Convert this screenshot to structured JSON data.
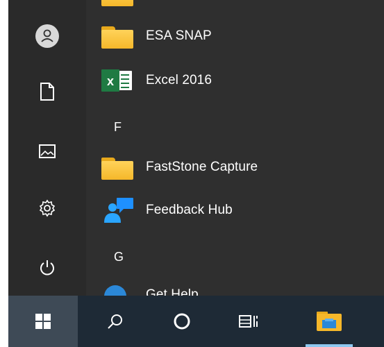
{
  "rail": {
    "items": [
      {
        "name": "user-account",
        "icon": "user-icon"
      },
      {
        "name": "documents",
        "icon": "document-icon"
      },
      {
        "name": "pictures",
        "icon": "pictures-icon"
      },
      {
        "name": "settings",
        "icon": "gear-icon"
      },
      {
        "name": "power",
        "icon": "power-icon"
      }
    ]
  },
  "app_list": {
    "apps": [
      {
        "label": "ESA SNAP",
        "icon": "folder-icon"
      },
      {
        "label": "Excel 2016",
        "icon": "excel-icon"
      },
      {
        "label": "FastStone Capture",
        "icon": "folder-icon"
      },
      {
        "label": "Feedback Hub",
        "icon": "feedback-hub-icon"
      },
      {
        "label": "Get Help",
        "icon": "get-help-icon"
      }
    ],
    "letters": [
      "F",
      "G"
    ]
  },
  "taskbar": {
    "items": [
      {
        "name": "start",
        "icon": "windows-icon"
      },
      {
        "name": "search",
        "icon": "search-icon"
      },
      {
        "name": "cortana",
        "icon": "cortana-icon"
      },
      {
        "name": "task-view",
        "icon": "task-view-icon"
      },
      {
        "name": "file-explorer",
        "icon": "file-explorer-icon"
      }
    ]
  },
  "colors": {
    "accent": "#8ec8f0",
    "folder": "#f5b72a",
    "excel": "#1f7a43",
    "taskbar": "#1e2a36"
  }
}
